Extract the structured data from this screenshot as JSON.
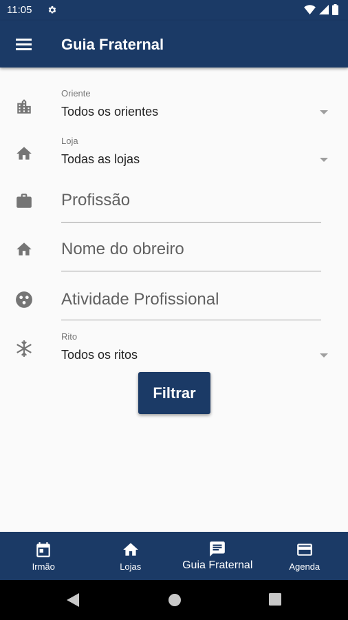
{
  "status": {
    "time": "11:05"
  },
  "appbar": {
    "title": "Guia Fraternal"
  },
  "form": {
    "oriente": {
      "label": "Oriente",
      "value": "Todos os orientes",
      "icon": "city-icon"
    },
    "loja": {
      "label": "Loja",
      "value": "Todas as lojas",
      "icon": "home-icon"
    },
    "profissao": {
      "placeholder": "Profissão",
      "icon": "briefcase-icon"
    },
    "obreiro": {
      "placeholder": "Nome do obreiro",
      "icon": "home-icon"
    },
    "atividade": {
      "placeholder": "Atividade Profissional",
      "icon": "palette-icon"
    },
    "rito": {
      "label": "Rito",
      "value": "Todos os ritos",
      "icon": "snowflake-icon"
    },
    "filter_label": "Filtrar"
  },
  "bottom_nav": {
    "items": [
      {
        "label": "Irmão",
        "icon": "calendar-icon"
      },
      {
        "label": "Lojas",
        "icon": "home-icon"
      },
      {
        "label": "Guia Fraternal",
        "icon": "message-icon",
        "active": true
      },
      {
        "label": "Agenda",
        "icon": "agenda-card-icon"
      }
    ]
  },
  "colors": {
    "primary": "#1b3a66",
    "background": "#fafafa",
    "icon_grey": "#757575"
  }
}
